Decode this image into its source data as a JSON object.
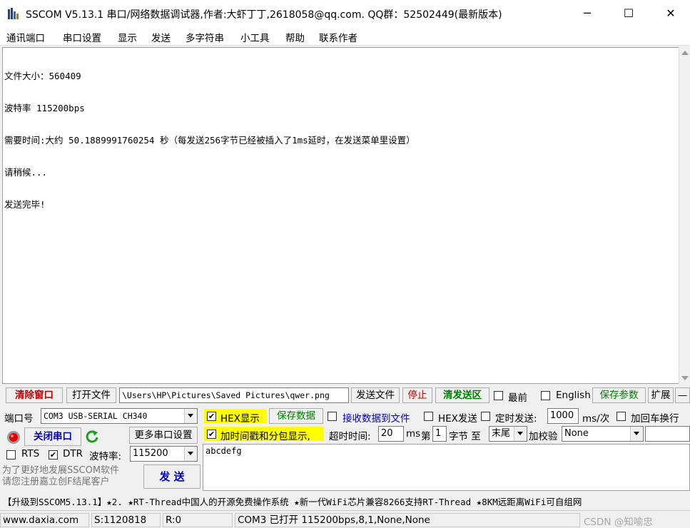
{
  "window": {
    "title": "SSCOM V5.13.1 串口/网络数据调试器,作者:大虾丁丁,2618058@qq.com. QQ群：52502449(最新版本)",
    "minimize_glyph": "─",
    "maximize_glyph": "☐",
    "close_glyph": "✕"
  },
  "menu": [
    "通讯端口",
    "串口设置",
    "显示",
    "发送",
    "多字符串",
    "小工具",
    "帮助",
    "联系作者"
  ],
  "receive": {
    "lines": [
      "文件大小：560409",
      "波特率 115200bps",
      "需要时间:大约 50.1889991760254 秒（每发送256字节已经被插入了1ms延时，在发送菜单里设置）",
      "请稍候...",
      "发送完毕!"
    ]
  },
  "toolbar": {
    "clear_window": "清除窗口",
    "open_file": "打开文件",
    "file_path": "\\Users\\HP\\Pictures\\Saved Pictures\\qwer.png",
    "send_file": "发送文件",
    "stop": "停止",
    "clear_send": "清发送区",
    "topmost": "最前",
    "english": "English",
    "save_params": "保存参数",
    "expand": "扩展",
    "collapse": "—"
  },
  "port": {
    "port_label": "端口号",
    "port_value": "COM3 USB-SERIAL CH340",
    "close_port": "关闭串口",
    "more_settings": "更多串口设置",
    "rts": "RTS",
    "dtr": "DTR",
    "baud_label": "波特率:",
    "baud_value": "115200",
    "promo": "为了更好地发展SSCOM软件\n请您注册嘉立创F结尾客户",
    "send_button": "发  送"
  },
  "options": {
    "hex_display": "HEX显示",
    "save_data": "保存数据",
    "recv_to_file": "接收数据到文件",
    "hex_send": "HEX发送",
    "timed_send": "定时发送:",
    "timed_value": "1000",
    "timed_unit": "ms/次",
    "add_crlf": "加回车换行",
    "timestamp": "加时间戳和分包显示,",
    "timeout_label": "超时时间:",
    "timeout_value": "20",
    "timeout_unit": "ms",
    "byte_prefix": "第",
    "byte_index": "1",
    "byte_label": "字节 至",
    "byte_end": "末尾",
    "checksum_label": "加校验",
    "checksum_value": "None"
  },
  "send_text": "abcdefg",
  "ticker": "【升级到SSCOM5.13.1】★2. ★RT-Thread中国人的开源免费操作系统 ★新一代WiFi芯片兼容8266支持RT-Thread ★8KM远距离WiFi可自组网",
  "status": {
    "website": "www.daxia.com",
    "sent": "S:1120818",
    "received": "R:0",
    "port_status": "COM3 已打开  115200bps,8,1,None,None",
    "watermark": "CSDN @知喻忠"
  },
  "colors": {
    "accent_red": "#c00000",
    "accent_green": "#008000",
    "highlight_yellow": "#ffff00"
  }
}
